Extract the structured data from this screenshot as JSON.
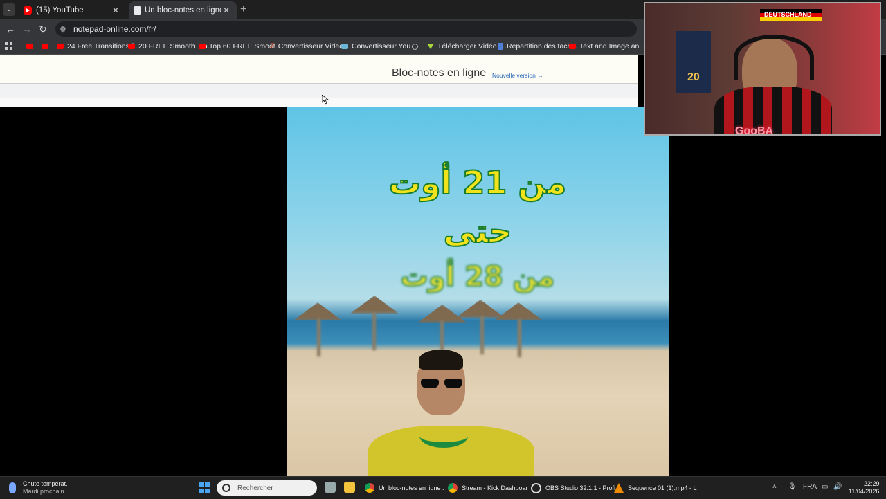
{
  "browser": {
    "tabs": [
      {
        "title": "(15) YouTube",
        "favicon": "youtube-icon",
        "active": false
      },
      {
        "title": "Un bloc-notes en ligne gratuit",
        "favicon": "document-icon",
        "active": true
      }
    ],
    "url": "notepad-online.com/fr/",
    "bookmarks": [
      {
        "label": "",
        "icon": "youtube-icon"
      },
      {
        "label": "",
        "icon": "youtube-icon"
      },
      {
        "label": "24 Free Transitions f...",
        "icon": "youtube-icon"
      },
      {
        "label": "20 FREE Smooth Tra...",
        "icon": "youtube-icon"
      },
      {
        "label": "Top 60 FREE Smoot...",
        "icon": "youtube-icon"
      },
      {
        "label": "Convertisseur Video...",
        "icon": "z-icon"
      },
      {
        "label": "Convertisseur YouT...",
        "icon": "flag-icon"
      },
      {
        "label": "",
        "icon": "globe-icon"
      },
      {
        "label": "Télécharger Vidéo Y...",
        "icon": "download-icon"
      },
      {
        "label": "Repartition des tach...",
        "icon": "docs-icon"
      },
      {
        "label": "Text and Image ani...",
        "icon": "youtube-icon"
      }
    ]
  },
  "page": {
    "title": "Bloc-notes en ligne",
    "new_version_link": "Nouvelle version →"
  },
  "video": {
    "overlay_lines": [
      "من 21 أوت",
      "حتى",
      "من 28 أوت"
    ]
  },
  "webcam": {
    "flag_text": "DEUTSCHLAND",
    "jersey_number": "20",
    "name_label": "GooBA"
  },
  "taskbar": {
    "weather_title": "Chute températ.",
    "weather_subtitle": "Mardi prochain",
    "search_placeholder": "Rechercher",
    "apps": [
      {
        "label": "Un bloc-notes en ligne :",
        "icon": "chrome-icon"
      },
      {
        "label": "Stream - Kick Dashboar",
        "icon": "chrome-icon"
      },
      {
        "label": "OBS Studio 32.1.1 - Profi",
        "icon": "obs-icon"
      },
      {
        "label": "Sequence 01 (1).mp4 - L",
        "icon": "vlc-icon"
      }
    ],
    "language": "FRA",
    "time": "22:29",
    "date": "11/04/2026"
  },
  "colors": {
    "tab_bg": "#1f1f1f",
    "toolbar_bg": "#35363a",
    "page_header_bg": "#fdfdf6",
    "link": "#2a6ab8",
    "overlay_fill": "#f1e21b",
    "overlay_stroke": "#177c2c"
  }
}
